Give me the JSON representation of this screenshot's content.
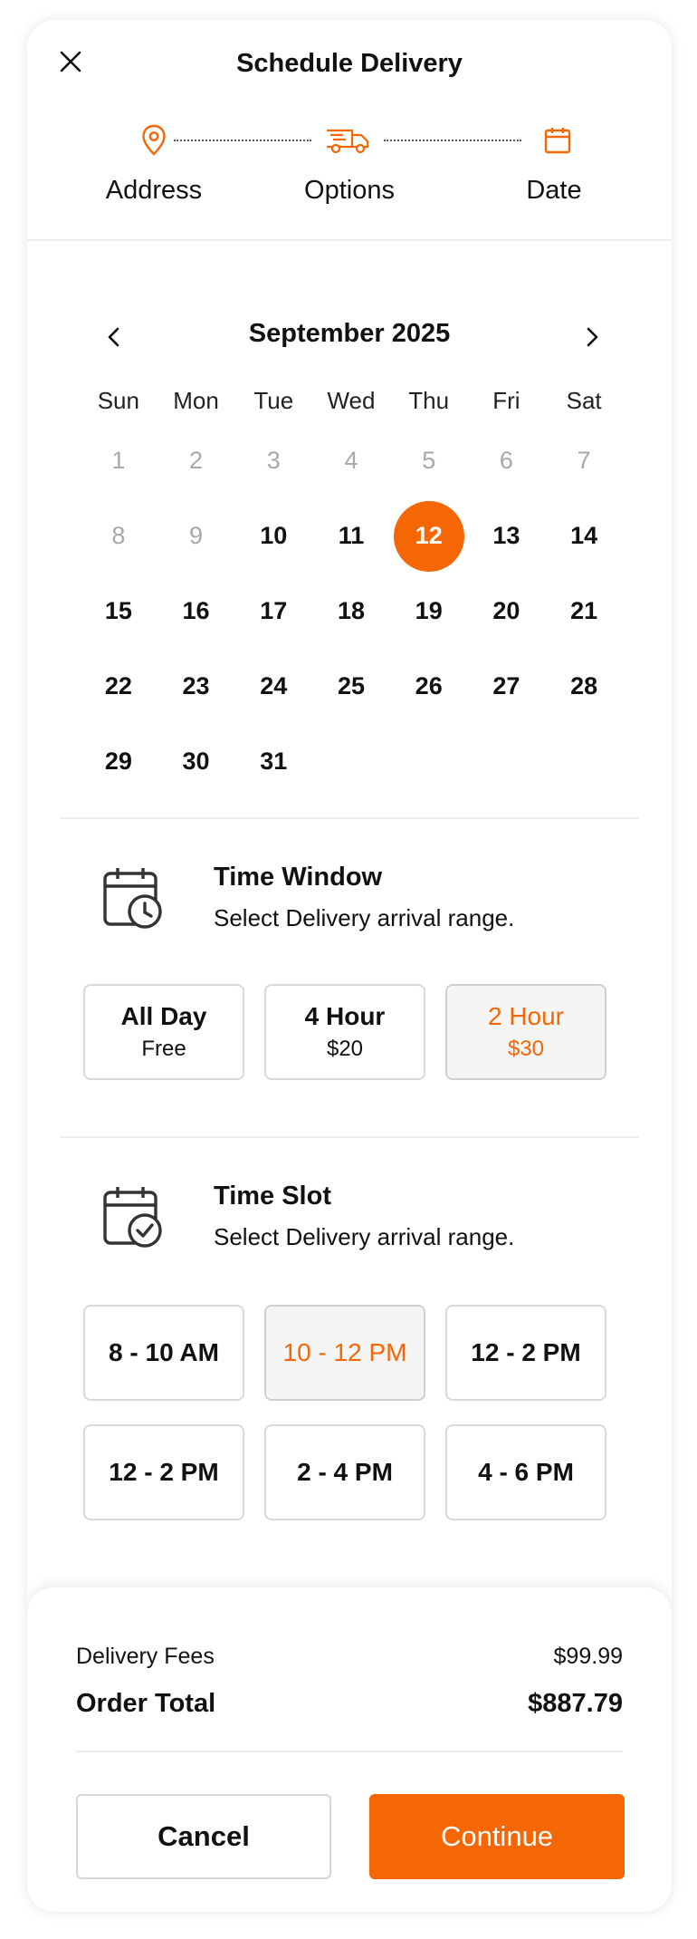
{
  "header": {
    "title": "Schedule Delivery",
    "close_icon": "close-icon"
  },
  "colors": {
    "accent": "#f56605",
    "text": "#111111",
    "muted": "#a8a8a8",
    "border": "#d9d9d9",
    "selected_bg": "#f5f5f5"
  },
  "stepper": {
    "steps": [
      {
        "label": "Address",
        "icon": "map-pin-icon"
      },
      {
        "label": "Options",
        "icon": "delivery-truck-icon"
      },
      {
        "label": "Date",
        "icon": "calendar-icon"
      }
    ]
  },
  "calendar": {
    "month_title": "September 2025",
    "prev_icon": "chevron-left-icon",
    "next_icon": "chevron-right-icon",
    "weekdays": [
      "Sun",
      "Mon",
      "Tue",
      "Wed",
      "Thu",
      "Fri",
      "Sat"
    ],
    "weeks": [
      [
        "1",
        "2",
        "3",
        "4",
        "5",
        "6",
        "7"
      ],
      [
        "8",
        "9",
        "10",
        "11",
        "12",
        "13",
        "14"
      ],
      [
        "15",
        "16",
        "17",
        "18",
        "19",
        "20",
        "21"
      ],
      [
        "22",
        "23",
        "24",
        "25",
        "26",
        "27",
        "28"
      ],
      [
        "29",
        "30",
        "31",
        "",
        "",
        "",
        ""
      ]
    ],
    "disabled_days": [
      "1",
      "2",
      "3",
      "4",
      "5",
      "6",
      "7",
      "8",
      "9"
    ],
    "selected_day": "12"
  },
  "time_window": {
    "icon": "calendar-clock-icon",
    "title": "Time Window",
    "subtitle": "Select Delivery arrival range.",
    "options": [
      {
        "label": "All Day",
        "price": "Free"
      },
      {
        "label": "4 Hour",
        "price": "$20"
      },
      {
        "label": "2 Hour",
        "price": "$30"
      }
    ],
    "selected": "2 Hour"
  },
  "time_slot": {
    "icon": "calendar-check-icon",
    "title": "Time Slot",
    "subtitle": "Select Delivery arrival range.",
    "slots": [
      "8  - 10 AM",
      "10 - 12 PM",
      "12 - 2 PM",
      "12  - 2 PM",
      "2 - 4 PM",
      "4 - 6 PM"
    ],
    "selected": "10 - 12 PM"
  },
  "summary": {
    "delivery_fees_label": "Delivery Fees",
    "delivery_fees_value": "$99.99",
    "order_total_label": "Order Total",
    "order_total_value": "$887.79"
  },
  "actions": {
    "cancel_label": "Cancel",
    "continue_label": "Continue"
  }
}
